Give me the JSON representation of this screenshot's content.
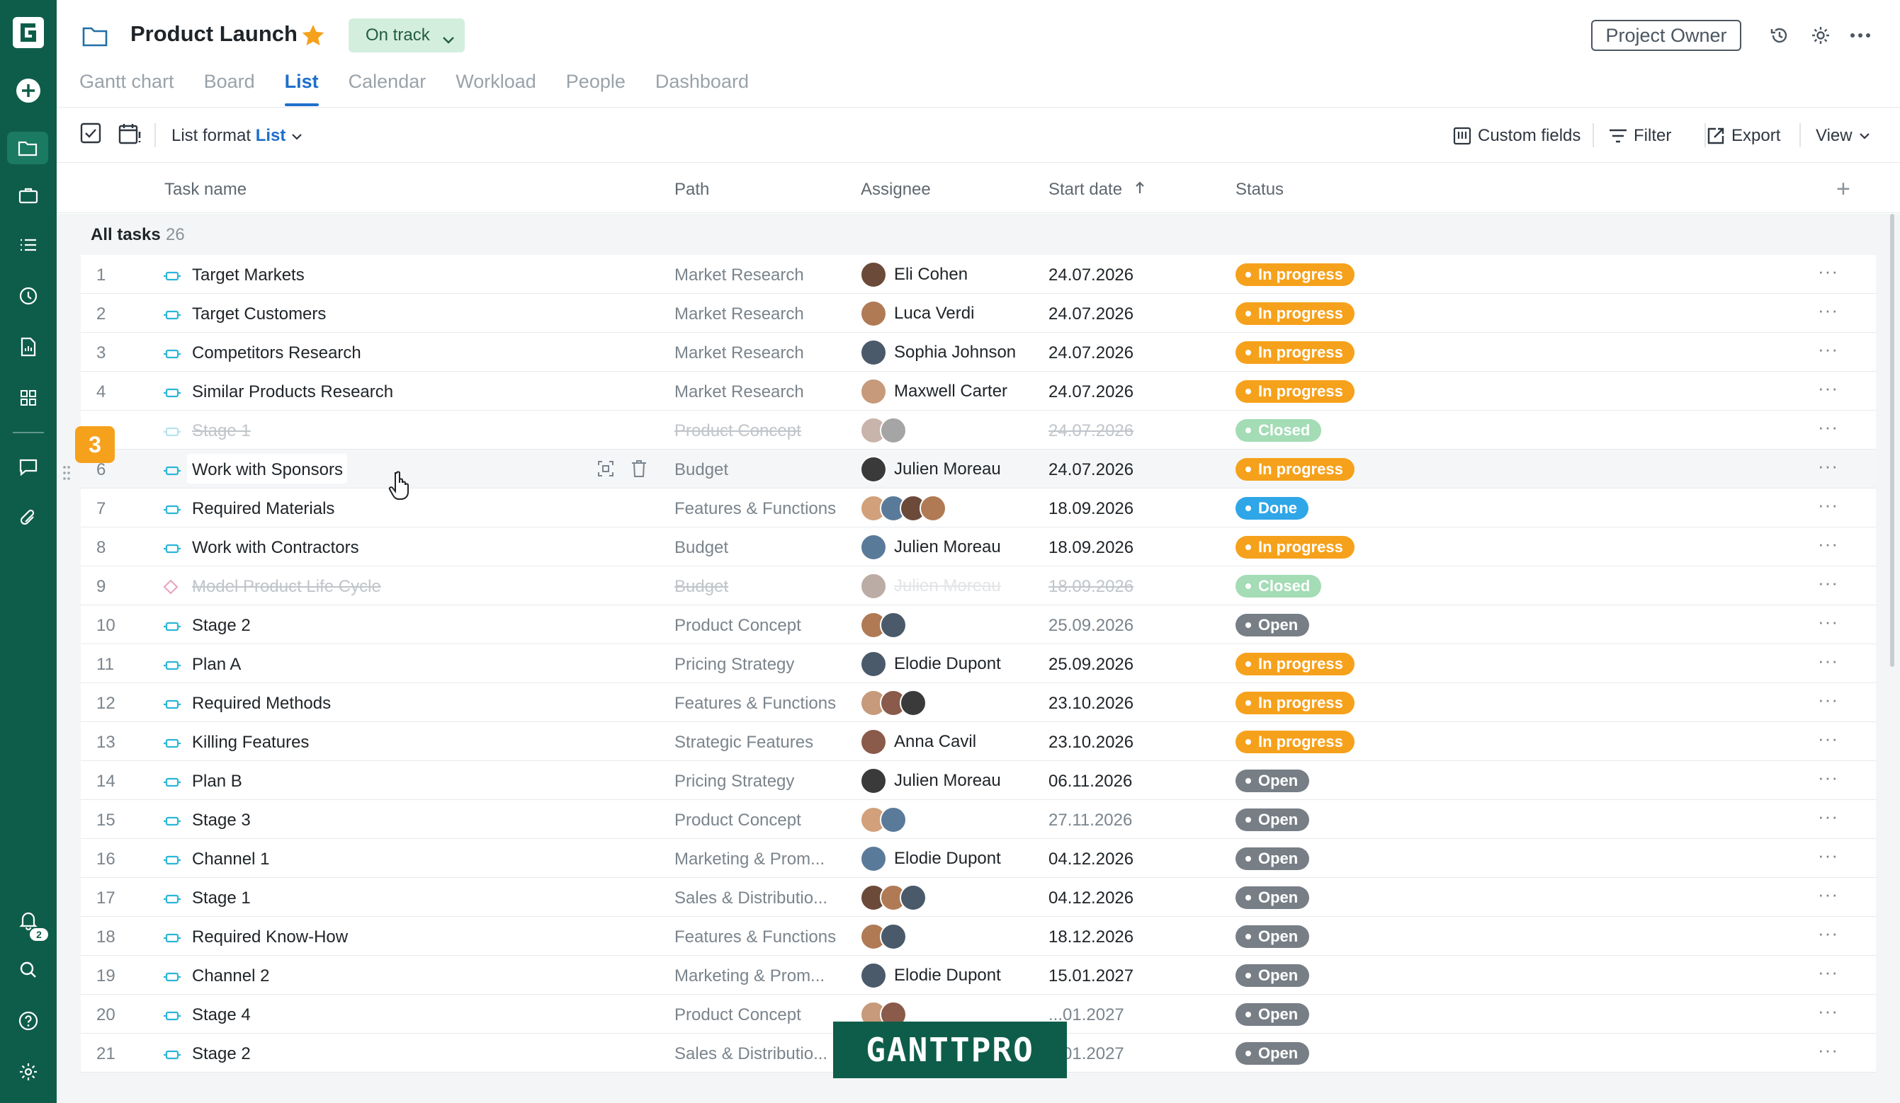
{
  "project": {
    "title": "Product Launch",
    "status_label": "On track",
    "owner_button": "Project Owner"
  },
  "tabs": [
    "Gantt chart",
    "Board",
    "List",
    "Calendar",
    "Workload",
    "People",
    "Dashboard"
  ],
  "active_tab": "List",
  "toolbar": {
    "list_format_label": "List format",
    "list_format_value": "List",
    "custom_fields": "Custom fields",
    "filter": "Filter",
    "export": "Export",
    "view": "View"
  },
  "columns": {
    "task_name": "Task name",
    "path": "Path",
    "assignee": "Assignee",
    "start_date": "Start date",
    "status": "Status"
  },
  "section": {
    "label": "All tasks",
    "count": "26"
  },
  "notifications_count": "2",
  "tag_number": "3",
  "watermark": "GANTTPRO",
  "colors": {
    "rail": "#0e5d4a",
    "accent": "#1f6fcb",
    "in_progress": "#f6a11b",
    "done": "#2ea6e8",
    "open": "#777e85",
    "closed": "#a3dcb5"
  },
  "rows": [
    {
      "num": "1",
      "name": "Target Markets",
      "path": "Market Research",
      "assignee": "Eli Cohen",
      "date": "24.07.2026",
      "status": "In progress",
      "avatars": 1
    },
    {
      "num": "2",
      "name": "Target Customers",
      "path": "Market Research",
      "assignee": "Luca Verdi",
      "date": "24.07.2026",
      "status": "In progress",
      "avatars": 1
    },
    {
      "num": "3",
      "name": "Competitors Research",
      "path": "Market Research",
      "assignee": "Sophia Johnson",
      "date": "24.07.2026",
      "status": "In progress",
      "avatars": 1
    },
    {
      "num": "4",
      "name": "Similar Products Research",
      "path": "Market Research",
      "assignee": "Maxwell Carter",
      "date": "24.07.2026",
      "status": "In progress",
      "avatars": 1
    },
    {
      "num": "",
      "name": "Stage 1",
      "path": "Product Concept",
      "assignee": "",
      "date": "24.07.2026",
      "status": "Closed",
      "avatars": 2
    },
    {
      "num": "6",
      "name": "Work with Sponsors",
      "path": "Budget",
      "assignee": "Julien Moreau",
      "date": "24.07.2026",
      "status": "In progress",
      "avatars": 1
    },
    {
      "num": "7",
      "name": "Required Materials",
      "path": "Features & Functions",
      "assignee": "",
      "date": "18.09.2026",
      "status": "Done",
      "avatars": 4
    },
    {
      "num": "8",
      "name": "Work with Contractors",
      "path": "Budget",
      "assignee": "Julien Moreau",
      "date": "18.09.2026",
      "status": "In progress",
      "avatars": 1
    },
    {
      "num": "9",
      "name": "Model Product Life Cycle",
      "path": "Budget",
      "assignee": "Julien Moreau",
      "date": "18.09.2026",
      "status": "Closed",
      "avatars": 1
    },
    {
      "num": "10",
      "name": "Stage 2",
      "path": "Product Concept",
      "assignee": "",
      "date": "25.09.2026",
      "status": "Open",
      "avatars": 2
    },
    {
      "num": "11",
      "name": "Plan A",
      "path": "Pricing Strategy",
      "assignee": "Elodie Dupont",
      "date": "25.09.2026",
      "status": "In progress",
      "avatars": 1
    },
    {
      "num": "12",
      "name": "Required Methods",
      "path": "Features & Functions",
      "assignee": "",
      "date": "23.10.2026",
      "status": "In progress",
      "avatars": 3
    },
    {
      "num": "13",
      "name": "Killing Features",
      "path": "Strategic Features",
      "assignee": "Anna Cavil",
      "date": "23.10.2026",
      "status": "In progress",
      "avatars": 1
    },
    {
      "num": "14",
      "name": "Plan B",
      "path": "Pricing Strategy",
      "assignee": "Julien Moreau",
      "date": "06.11.2026",
      "status": "Open",
      "avatars": 1
    },
    {
      "num": "15",
      "name": "Stage 3",
      "path": "Product Concept",
      "assignee": "",
      "date": "27.11.2026",
      "status": "Open",
      "avatars": 2
    },
    {
      "num": "16",
      "name": "Channel 1",
      "path": "Marketing & Prom...",
      "assignee": "Elodie Dupont",
      "date": "04.12.2026",
      "status": "Open",
      "avatars": 1
    },
    {
      "num": "17",
      "name": "Stage 1",
      "path": "Sales & Distributio...",
      "assignee": "",
      "date": "04.12.2026",
      "status": "Open",
      "avatars": 3
    },
    {
      "num": "18",
      "name": "Required Know-How",
      "path": "Features & Functions",
      "assignee": "",
      "date": "18.12.2026",
      "status": "Open",
      "avatars": 2
    },
    {
      "num": "19",
      "name": "Channel 2",
      "path": "Marketing & Prom...",
      "assignee": "Elodie Dupont",
      "date": "15.01.2027",
      "status": "Open",
      "avatars": 1
    },
    {
      "num": "20",
      "name": "Stage 4",
      "path": "Product Concept",
      "assignee": "",
      "date": "...01.2027",
      "status": "Open",
      "avatars": 2
    },
    {
      "num": "21",
      "name": "Stage 2",
      "path": "Sales & Distributio...",
      "assignee": "",
      "date": "...01.2027",
      "status": "Open",
      "avatars": 3
    }
  ]
}
